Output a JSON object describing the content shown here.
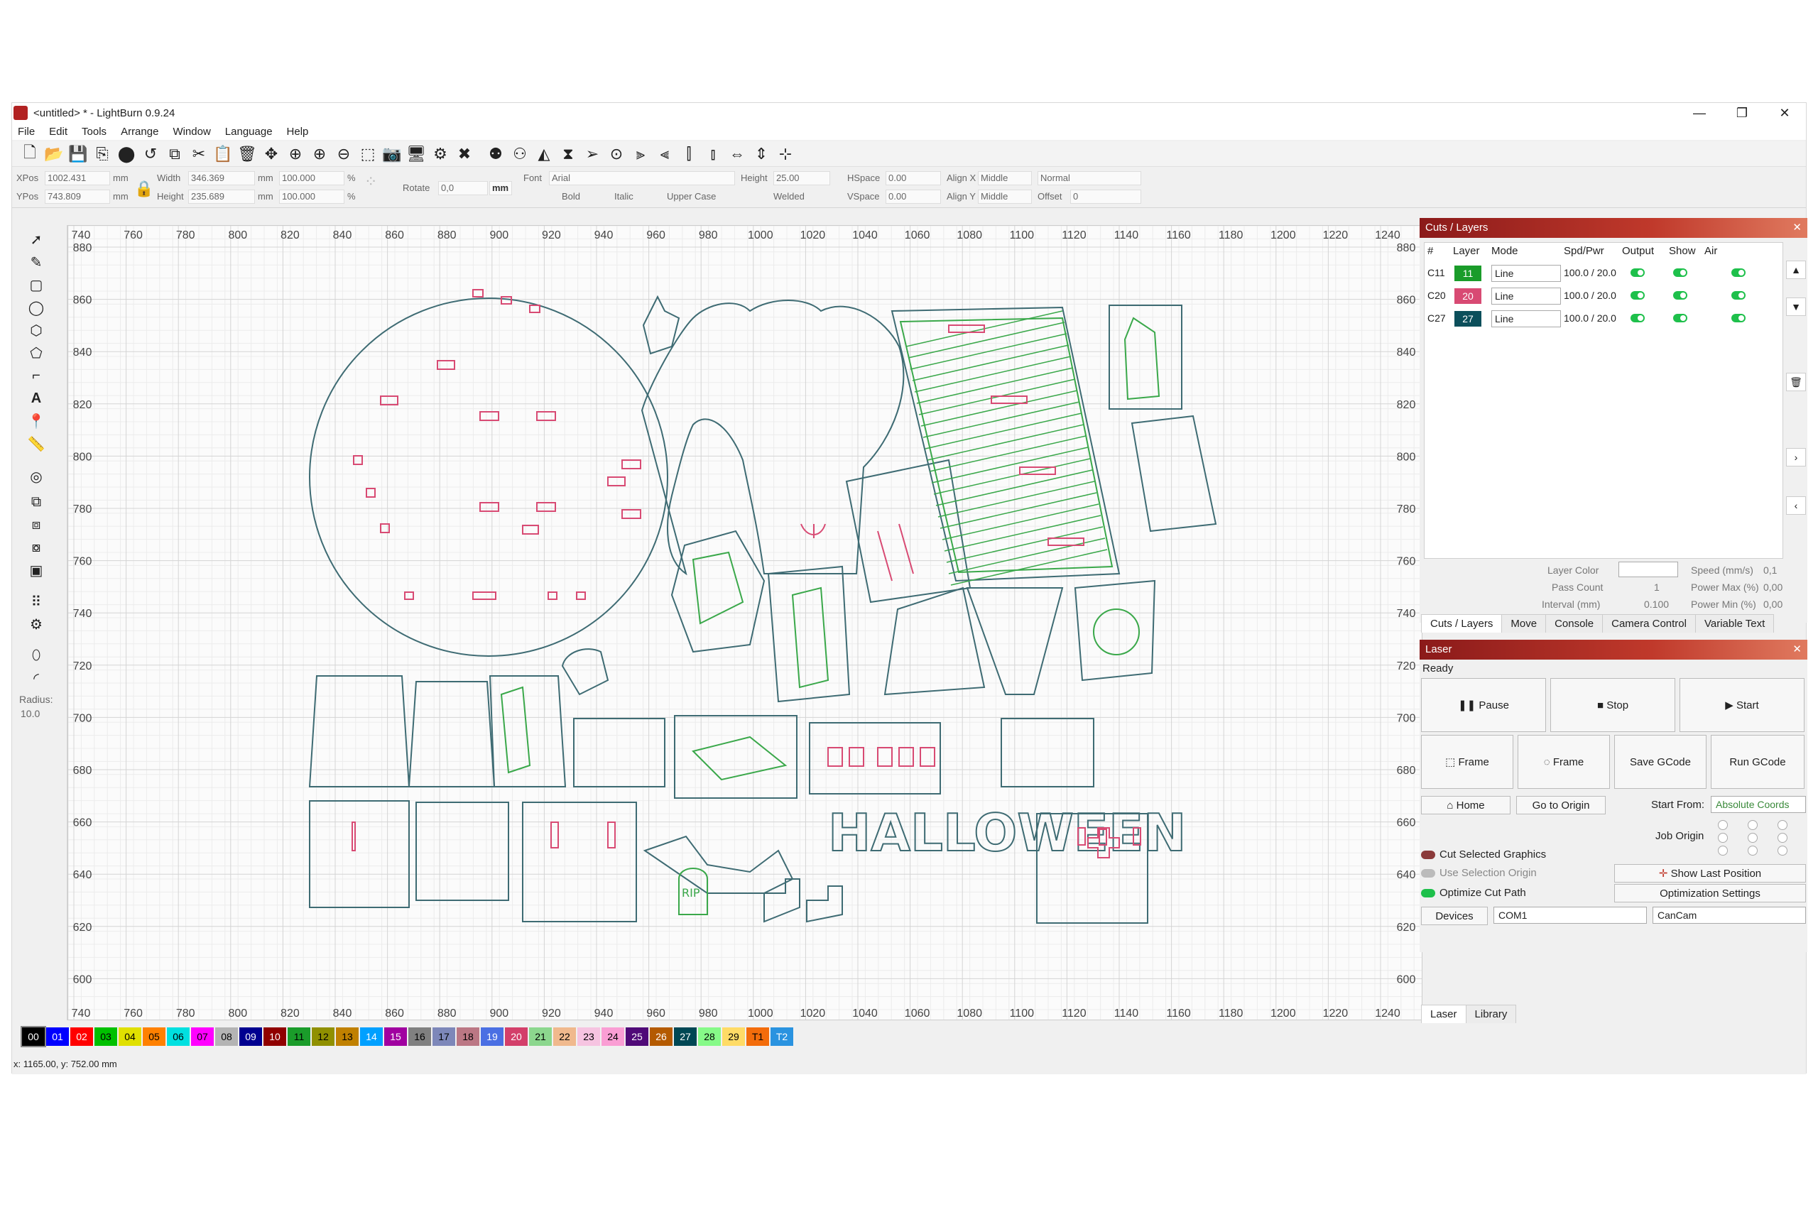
{
  "window": {
    "title": "<untitled> * - LightBurn 0.9.24",
    "minimize": "—",
    "maximize": "❐",
    "close": "✕"
  },
  "menu": [
    "File",
    "Edit",
    "Tools",
    "Arrange",
    "Window",
    "Language",
    "Help"
  ],
  "props": {
    "xpos_label": "XPos",
    "xpos": "1002.431",
    "ypos_label": "YPos",
    "ypos": "743.809",
    "unit": "mm",
    "width_label": "Width",
    "width": "346.369",
    "height_label": "Height",
    "height": "235.689",
    "pct1": "100.000",
    "pct2": "100.000",
    "pct": "%",
    "rotate_label": "Rotate",
    "rotate": "0,0",
    "mm_btn": "mm",
    "font_label": "Font",
    "font": "Arial",
    "fheight_label": "Height",
    "fheight": "25.00",
    "hspace_label": "HSpace",
    "hspace": "0.00",
    "vspace_label": "VSpace",
    "vspace": "0.00",
    "alignx_label": "Align X",
    "alignx": "Middle",
    "aligny_label": "Align Y",
    "aligny": "Middle",
    "normal": "Normal",
    "offset_label": "Offset",
    "offset": "0",
    "bold": "Bold",
    "italic": "Italic",
    "upper": "Upper Case",
    "welded": "Welded"
  },
  "left": {
    "radius_label": "Radius:",
    "radius": "10.0"
  },
  "ruler": {
    "x": [
      "740",
      "760",
      "780",
      "800",
      "820",
      "840",
      "860",
      "880",
      "900",
      "920",
      "940",
      "960",
      "980",
      "1000",
      "1020",
      "1040",
      "1060",
      "1080",
      "1100",
      "1120",
      "1140",
      "1160",
      "1180",
      "1200",
      "1220",
      "1240"
    ],
    "y": [
      "880",
      "860",
      "840",
      "820",
      "800",
      "780",
      "760",
      "740",
      "720",
      "700",
      "680",
      "660",
      "640",
      "620",
      "600"
    ]
  },
  "cuts": {
    "title": "Cuts / Layers",
    "headers": [
      "#",
      "Layer",
      "Mode",
      "Spd/Pwr",
      "Output",
      "Show",
      "Air"
    ],
    "rows": [
      {
        "id": "C11",
        "layer": "11",
        "color": "#1a9c2a",
        "mode": "Line",
        "spd": "100.0 / 20.0"
      },
      {
        "id": "C20",
        "layer": "20",
        "color": "#d84a73",
        "mode": "Line",
        "spd": "100.0 / 20.0"
      },
      {
        "id": "C27",
        "layer": "27",
        "color": "#0c4f5b",
        "mode": "Line",
        "spd": "100.0 / 20.0"
      }
    ],
    "layer_color": "Layer Color",
    "pass_count": "Pass Count",
    "pass_val": "1",
    "interval": "Interval (mm)",
    "interval_val": "0.100",
    "speed": "Speed (mm/s)",
    "speed_val": "0,1",
    "pmax": "Power Max (%)",
    "pmax_val": "0,00",
    "pmin": "Power Min (%)",
    "pmin_val": "0,00",
    "tabs": [
      "Cuts / Layers",
      "Move",
      "Console",
      "Camera Control",
      "Variable Text"
    ]
  },
  "laser": {
    "title": "Laser",
    "status": "Ready",
    "pause": "Pause",
    "stop": "Stop",
    "start": "Start",
    "frame1": "Frame",
    "frame2": "Frame",
    "save_gcode": "Save GCode",
    "run_gcode": "Run GCode",
    "home": "Home",
    "go_origin": "Go to Origin",
    "start_from": "Start From:",
    "start_from_val": "Absolute Coords",
    "job_origin": "Job Origin",
    "cut_selected": "Cut Selected Graphics",
    "use_sel_origin": "Use Selection Origin",
    "show_last": "Show Last Position",
    "optimize": "Optimize Cut Path",
    "opt_settings": "Optimization Settings",
    "devices": "Devices",
    "port": "COM1",
    "device": "CanCam",
    "tabs": [
      "Laser",
      "Library"
    ]
  },
  "palette": [
    {
      "t": "00",
      "c": "#000000",
      "f": "#ffffff"
    },
    {
      "t": "01",
      "c": "#0000ff",
      "f": "#ffffff"
    },
    {
      "t": "02",
      "c": "#ff0000",
      "f": "#ffffff"
    },
    {
      "t": "03",
      "c": "#00c000",
      "f": "#000000"
    },
    {
      "t": "04",
      "c": "#e0e000",
      "f": "#000000"
    },
    {
      "t": "05",
      "c": "#ff8000",
      "f": "#000000"
    },
    {
      "t": "06",
      "c": "#00e0e0",
      "f": "#000000"
    },
    {
      "t": "07",
      "c": "#ff00ff",
      "f": "#000000"
    },
    {
      "t": "08",
      "c": "#b4b4b4",
      "f": "#000000"
    },
    {
      "t": "09",
      "c": "#000090",
      "f": "#ffffff"
    },
    {
      "t": "10",
      "c": "#900000",
      "f": "#ffffff"
    },
    {
      "t": "11",
      "c": "#1a9c2a",
      "f": "#000000"
    },
    {
      "t": "12",
      "c": "#909000",
      "f": "#000000"
    },
    {
      "t": "13",
      "c": "#c08000",
      "f": "#000000"
    },
    {
      "t": "14",
      "c": "#00a0ff",
      "f": "#ffffff"
    },
    {
      "t": "15",
      "c": "#a000a0",
      "f": "#ffffff"
    },
    {
      "t": "16",
      "c": "#808080",
      "f": "#000000"
    },
    {
      "t": "17",
      "c": "#7d87b9",
      "f": "#000000"
    },
    {
      "t": "18",
      "c": "#bb7784",
      "f": "#000000"
    },
    {
      "t": "19",
      "c": "#4a6fe3",
      "f": "#ffffff"
    },
    {
      "t": "20",
      "c": "#d33f6a",
      "f": "#ffffff"
    },
    {
      "t": "21",
      "c": "#8cd78e",
      "f": "#000000"
    },
    {
      "t": "22",
      "c": "#f0b98d",
      "f": "#000000"
    },
    {
      "t": "23",
      "c": "#f6c4e1",
      "f": "#000000"
    },
    {
      "t": "24",
      "c": "#fa9ed4",
      "f": "#000000"
    },
    {
      "t": "25",
      "c": "#500a78",
      "f": "#ffffff"
    },
    {
      "t": "26",
      "c": "#b45a00",
      "f": "#ffffff"
    },
    {
      "t": "27",
      "c": "#004754",
      "f": "#ffffff"
    },
    {
      "t": "28",
      "c": "#86fa88",
      "f": "#000000"
    },
    {
      "t": "29",
      "c": "#ffdb66",
      "f": "#000000"
    },
    {
      "t": "T1",
      "c": "#f36c0b",
      "f": "#000000"
    },
    {
      "t": "T2",
      "c": "#2a93e0",
      "f": "#ffffff"
    }
  ],
  "status": {
    "coords": "x: 1165.00, y: 752.00 mm"
  },
  "design": {
    "halloween": "HALLOWEEN",
    "rip": "RIP"
  }
}
